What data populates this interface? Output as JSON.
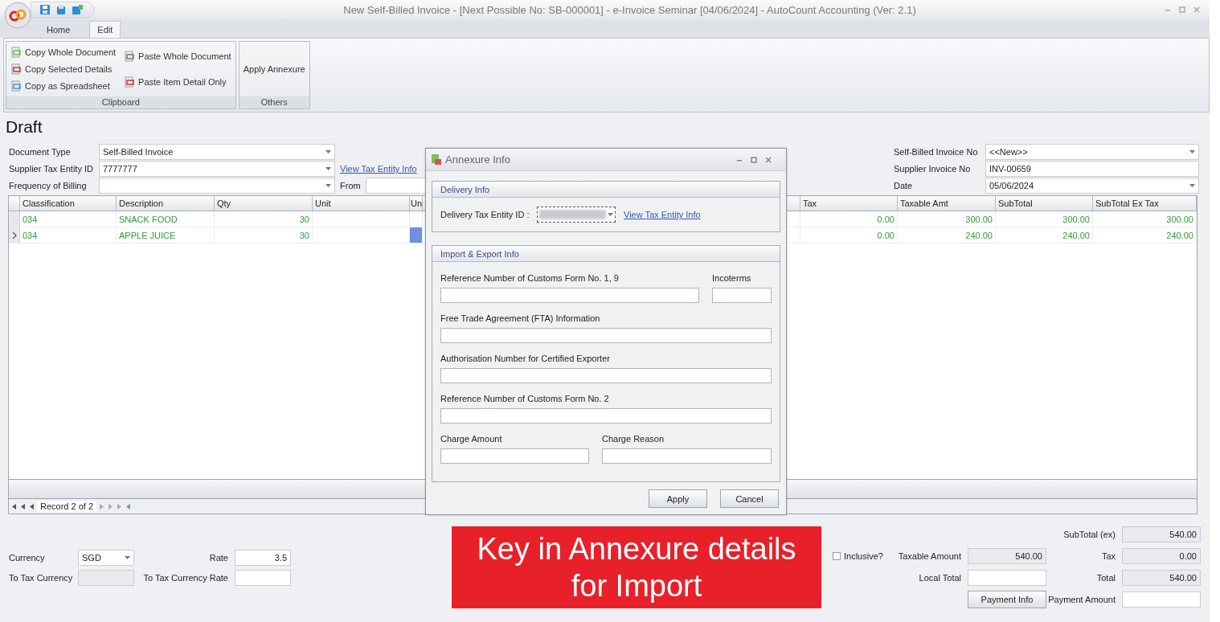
{
  "window": {
    "title": "New Self-Billed Invoice - [Next Possible No: SB-000001] - e-Invoice Seminar [04/06/2024] - AutoCount Accounting (Ver: 2.1)"
  },
  "ribbon": {
    "tabs": [
      {
        "label": "Home",
        "selected": false
      },
      {
        "label": "Edit",
        "selected": true
      }
    ],
    "groups": [
      {
        "title": "Clipboard",
        "columns": [
          [
            {
              "label": "Copy Whole Document",
              "kind": "icon"
            },
            {
              "label": "Copy Selected Details",
              "kind": "icon"
            },
            {
              "label": "Copy as Spreadsheet",
              "kind": "icon"
            }
          ],
          [
            {
              "label": "Paste Whole Document",
              "kind": "icon"
            },
            {
              "label": "Paste Item Detail Only",
              "kind": "icon"
            }
          ]
        ]
      },
      {
        "title": "Others",
        "columns": [
          [
            {
              "label": "Apply Annexure",
              "kind": "text"
            }
          ]
        ]
      }
    ]
  },
  "page_title": "Draft",
  "header_left": [
    {
      "label": "Document Type",
      "value": "Self-Billed Invoice",
      "kind": "dropdown"
    },
    {
      "label": "Supplier Tax Entity ID",
      "value": "7777777",
      "kind": "dropdown",
      "link": "View Tax Entity Info"
    },
    {
      "label": "Frequency of Billing",
      "kind": "dropdown",
      "side_label": "From"
    }
  ],
  "header_right": [
    {
      "label": "Self-Billed Invoice No",
      "value": "<<New>>",
      "kind": "dropdown"
    },
    {
      "label": "Supplier Invoice No",
      "value": "INV-00659",
      "kind": "text"
    },
    {
      "label": "Date",
      "value": "05/06/2024",
      "kind": "dropdown"
    }
  ],
  "grid": {
    "columns": [
      {
        "label": "Classification",
        "kind": "text"
      },
      {
        "label": "Description",
        "kind": "text"
      },
      {
        "label": "Qty",
        "kind": "number"
      },
      {
        "label": "Unit",
        "kind": "text"
      },
      {
        "label": "Un",
        "kind": "text"
      },
      {
        "kind": "hidden"
      },
      {
        "label": "Tax",
        "kind": "number"
      },
      {
        "label": "Taxable Amt",
        "kind": "number"
      },
      {
        "label": "SubTotal",
        "kind": "number"
      },
      {
        "label": "SubTotal Ex Tax",
        "kind": "number"
      }
    ],
    "rows": [
      {
        "selected": false,
        "cells": [
          "034",
          "SNACK FOOD",
          "30",
          null,
          null,
          null,
          "0.00",
          "300.00",
          "300.00",
          "300.00"
        ]
      },
      {
        "selected": true,
        "cells": [
          "034",
          "APPLE JUICE",
          "30",
          null,
          null,
          null,
          "0.00",
          "240.00",
          "240.00",
          "240.00"
        ]
      }
    ],
    "record": "Record 2 of 2"
  },
  "currency": [
    {
      "label": "Currency",
      "value": "SGD",
      "kind": "dropdown"
    },
    {
      "label": "Rate",
      "value": "3.5",
      "kind": "number"
    },
    {
      "label": "To Tax Currency",
      "kind": "readonly"
    },
    {
      "label": "To Tax Currency Rate",
      "kind": "number"
    }
  ],
  "inclusive": {
    "label": "Inclusive?",
    "checked": false
  },
  "amounts": [
    {
      "label": "Taxable Amount",
      "value": "540.00",
      "readonly": true
    },
    {
      "label": "Local Total",
      "readonly": false
    }
  ],
  "payment_button": "Payment Info",
  "totals": [
    {
      "label": "SubTotal (ex)",
      "value": "540.00",
      "readonly": true
    },
    {
      "label": "Tax",
      "value": "0.00",
      "readonly": true
    },
    {
      "label": "Total",
      "value": "540.00",
      "readonly": true
    },
    {
      "label": "Payment Amount",
      "readonly": false
    }
  ],
  "dialog": {
    "title": "Annexure Info",
    "delivery": {
      "title": "Delivery Info",
      "label": "Delivery Tax Entity ID :",
      "link": "View Tax Entity Info"
    },
    "import_export": {
      "title": "Import & Export Info",
      "rows": [
        [
          {
            "label": "Reference Number of Customs Form No. 1, 9"
          },
          {
            "label": "Incoterms"
          }
        ],
        [
          {
            "label": "Free Trade Agreement (FTA) Information"
          }
        ],
        [
          {
            "label": "Authorisation Number for Certified Exporter"
          }
        ],
        [
          {
            "label": "Reference Number of Customs Form No. 2"
          }
        ],
        [
          {
            "label": "Charge Amount"
          },
          {
            "label": "Charge Reason"
          }
        ]
      ]
    },
    "buttons": [
      "Apply",
      "Cancel"
    ]
  },
  "banner": {
    "text": "Key in Annexure details for Import"
  }
}
